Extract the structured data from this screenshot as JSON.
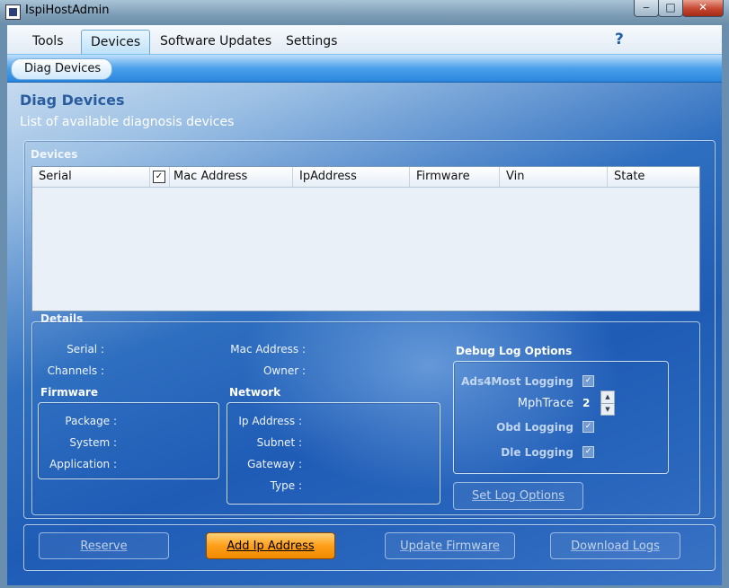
{
  "window": {
    "title": "IspiHostAdmin",
    "min": "‒",
    "max": "□",
    "close": "✕"
  },
  "tabs": [
    {
      "label": "Tools"
    },
    {
      "label": "Devices"
    },
    {
      "label": "Software Updates"
    },
    {
      "label": "Settings"
    }
  ],
  "help": "?",
  "breadcrumb": "Diag Devices",
  "page": {
    "title": "Diag Devices",
    "subtitle": "List of available diagnosis devices"
  },
  "devices": {
    "label": "Devices",
    "columns": [
      "Serial",
      "Mac Address",
      "IpAddress",
      "Firmware",
      "Vin",
      "State"
    ],
    "check_mark": "✓",
    "rows": []
  },
  "details": {
    "label": "Details",
    "serial": "Serial :",
    "channels": "Channels :",
    "mac": "Mac Address :",
    "owner": "Owner :",
    "firmware": {
      "label": "Firmware",
      "package": "Package :",
      "system": "System :",
      "application": "Application :"
    },
    "network": {
      "label": "Network",
      "ip": "Ip Address :",
      "subnet": "Subnet :",
      "gateway": "Gateway :",
      "type": "Type :"
    },
    "debug": {
      "label": "Debug Log Options",
      "ads4most": "Ads4Most Logging",
      "mphtrace": "MphTrace",
      "mphtrace_value": "2",
      "obd": "Obd Logging",
      "dle": "Dle Logging",
      "check": "✓",
      "set_button": "Set Log Options"
    }
  },
  "footer": {
    "reserve": "Reserve",
    "add_ip": "Add Ip Address",
    "update_fw": "Update Firmware",
    "download": "Download Logs"
  }
}
